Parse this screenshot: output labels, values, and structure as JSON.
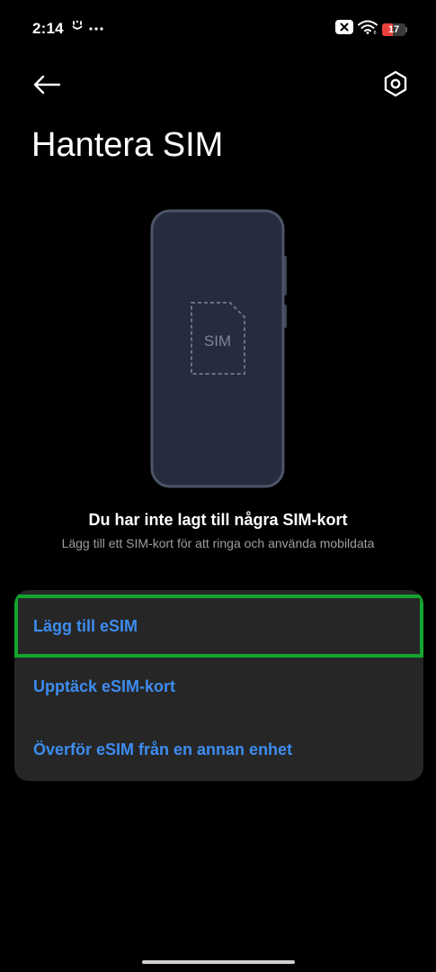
{
  "status_bar": {
    "time": "2:14",
    "battery_level": "17",
    "battery_fraction": 0.17,
    "battery_color": "#e8413c",
    "left_icons": [
      "download-status-icon",
      "more-notifications-icon"
    ],
    "right_icons": [
      "close-notification-icon",
      "wifi-icon",
      "battery-icon"
    ]
  },
  "app_bar": {
    "back_icon": "arrow-left-icon",
    "settings_icon": "hexagon-settings-icon"
  },
  "page": {
    "title": "Hantera SIM"
  },
  "illustration": {
    "sim_label": "SIM"
  },
  "empty_state": {
    "heading": "Du har inte lagt till några SIM-kort",
    "subtext": "Lägg till ett SIM-kort för att ringa och använda mobildata"
  },
  "actions": [
    {
      "label": "Lägg till eSIM",
      "highlighted": true
    },
    {
      "label": "Upptäck eSIM-kort",
      "highlighted": false
    },
    {
      "label": "Överför eSIM från en annan enhet",
      "highlighted": false
    }
  ],
  "colors": {
    "background": "#000000",
    "card": "#262626",
    "action_text": "#3d8cf0",
    "highlight_border": "#13a52e",
    "subtext": "#9e9e9e"
  }
}
